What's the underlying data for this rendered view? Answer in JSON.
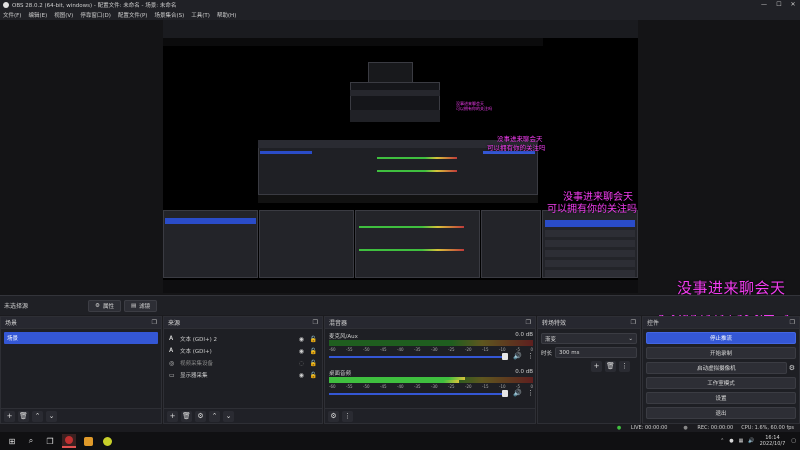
{
  "window": {
    "title": "OBS 28.0.2 (64-bit, windows) - 配置文件: 未命名 - 场景: 未命名",
    "controls": [
      "—",
      "☐",
      "✕"
    ]
  },
  "menu": [
    "文件(F)",
    "编辑(E)",
    "视图(V)",
    "停靠窗口(D)",
    "配置文件(P)",
    "场景集合(S)",
    "工具(T)",
    "帮助(H)"
  ],
  "overlay": {
    "line1": "没事进来聊会天",
    "line2": "可以拥有你的关注吗"
  },
  "scene_bar": {
    "label": "未选择源",
    "properties": "属性",
    "filters": "滤镜",
    "gear": "⚙",
    "filter_icon": "▤"
  },
  "docks": {
    "scenes": {
      "title": "场景",
      "items": [
        "场景"
      ]
    },
    "sources": {
      "title": "来源",
      "items": [
        {
          "icon": "text-icon",
          "name": "文本 (GDI+) 2"
        },
        {
          "icon": "text-icon",
          "name": "文本 (GDI+)"
        },
        {
          "icon": "camera-icon",
          "name": "视频采集设备"
        },
        {
          "icon": "monitor-icon",
          "name": "显示器采集"
        }
      ]
    },
    "mixer": {
      "title": "混音器",
      "channels": [
        {
          "name": "麦克风/Aux",
          "db": "0.0 dB"
        },
        {
          "name": "桌面音频",
          "db": "0.0 dB"
        }
      ],
      "ticks": [
        "-60",
        "-55",
        "-50",
        "-45",
        "-40",
        "-35",
        "-30",
        "-25",
        "-20",
        "-15",
        "-10",
        "-5",
        "0"
      ]
    },
    "transitions": {
      "title": "转场特效",
      "type": "渐变",
      "duration_label": "时长",
      "duration": "300 ms"
    },
    "controls": {
      "title": "控件",
      "buttons": [
        "停止推流",
        "开始录制",
        "启动虚拟摄像机",
        "工作室模式",
        "设置",
        "退出"
      ]
    }
  },
  "status": {
    "live": "LIVE: 00:00:00",
    "rec": "REC: 00:00:00",
    "cpu": "CPU: 1.6%, 60.00 fps"
  },
  "taskbar": {
    "time": "16:14",
    "date": "2022/10/7"
  },
  "colors": {
    "accent": "#3457d5",
    "overlay_text": "#f23cf0"
  }
}
